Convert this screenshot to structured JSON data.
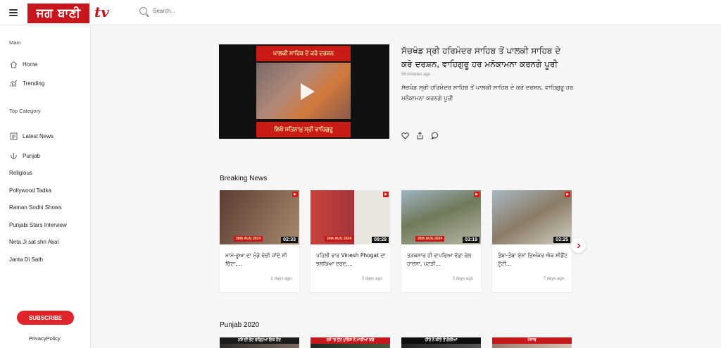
{
  "header": {
    "logo_text": "ਜਗ ਬਾਣੀ",
    "logo_tv": "tv",
    "search_placeholder": "Search..."
  },
  "sidebar": {
    "main_title": "Main",
    "home": "Home",
    "trending": "Trending",
    "top_category_title": "Top Category",
    "latest_news": "Latest News",
    "punjab": "Punjab",
    "categories": [
      "Religious",
      "Pollywood Tadka",
      "Raman Sodhi Shows",
      "Punjabi Stars Interview",
      "Neta Ji sat shri Akal",
      "Janta Di Sath"
    ],
    "subscribe": "SUBSCRIBE",
    "privacy": "PrivacyPolicy"
  },
  "featured": {
    "title": "ਸੱਚਖੰਡ ਸ੍ਰੀ ਹਰਿਮੰਦਰ ਸਾਹਿਬ ਤੋਂ ਪਾਲਕੀ ਸਾਹਿਬ ਦੇ ਕਰੋ ਦਰਸ਼ਨ, ਵਾਹਿਗੁਰੂ ਹਰ ਮਨੋਕਾਮਨਾ ਕਰਨਗੇ ਪੂਰੀ",
    "time": "56 minutes ago",
    "description": "ਸੱਚਖੰਡ ਸ੍ਰੀ ਹਰਿਮੰਦਰ ਸਾਹਿਬ ਤੋਂ ਪਾਲਕੀ ਸਾਹਿਬ ਦੇ ਕਰੋ ਦਰਸ਼ਨ, ਵਾਹਿਗੁਰੂ ਹਰ ਮਨੋਕਾਮਨਾ ਕਰਨਗੇ ਪੂਰੀ",
    "banner_top": "ਪਾਲਕੀ ਸਾਹਿਬ ਦੇ ਕਰੋ ਦਰਸ਼ਨ",
    "banner_bottom": "ਲਿਖੋ ਸਤਿਨਾਮੁ ਸ੍ਰੀ ਵਾਹਿਗੁਰੂ"
  },
  "breaking": {
    "title": "Breaking News",
    "cards": [
      {
        "title": "ਮਾਮੇ-ਭੂਆ ਦਾ ਮੁੰਡੇ ਵੇਚੀ ਜਾਂਦੇ ਸੀ ਚਿੱਟਾ,...",
        "time": "2 days ago",
        "duration": "02:33",
        "date_tag": "30th AUG 2024",
        "colors": [
          "#5a3c32",
          "#a88a70"
        ]
      },
      {
        "title": "ਪਹਿਲੀ ਵਾਰ Vinesh Phogat ਦਾ ਝਲਕਿਆ ਦਰਦ,...",
        "time": "3 days ago",
        "duration": "09:29",
        "date_tag": "30th AUG 2024",
        "colors": [
          "#c8433a",
          "#e9e6e0"
        ]
      },
      {
        "title": "ਤੜਕਸਾਰ ਹੀ ਵਾਪਰਿਆ ਵੱਡਾ ਰੇਲ ਹਾਦਸਾ, ਪਟੜੀ...",
        "time": "3 days ago",
        "duration": "03:19",
        "date_tag": "30th AUG 2024",
        "colors": [
          "#6f7a5a",
          "#b9b6a8"
        ]
      },
      {
        "title": "ਤੰਬਾ-ਤੰਬਾ ਏਨਾਂ ਭਿਅੰਕਰ ਐਕ ਸੀਡੈਂਟ ਟੁੱਟੀ...",
        "time": "7 days ago",
        "duration": "03:25",
        "date_tag": "",
        "colors": [
          "#8a7b66",
          "#d2d0c6"
        ]
      }
    ]
  },
  "punjab": {
    "title": "Punjab 2020",
    "cards": [
      {
        "band": "ਨਸ਼ੇ ਦੀ ਭੇਟ ਚੜ੍ਹਿਆ ਇਕ ਹੋਰ",
        "colors": [
          "#2e2b28",
          "#7b6b5f"
        ]
      },
      {
        "band": "ਨਸ਼ੇ 'ਚ ਧੁੱਤ ਪੁਲਿਸ ਨੇ ਮਾਰੀਆਂ ਬਚੇ",
        "colors": [
          "#1e2a22",
          "#4a5a3e"
        ]
      },
      {
        "band": "ਹੀਰੇ ਨੇ ਕੀਤੇ ਤੋਂ ਗੋਲੀਆਂ",
        "colors": [
          "#222",
          "#555"
        ]
      },
      {
        "band": "ਪੰਜਾਬ",
        "colors": [
          "#9a7a6a",
          "#d6c3b4"
        ]
      }
    ]
  }
}
